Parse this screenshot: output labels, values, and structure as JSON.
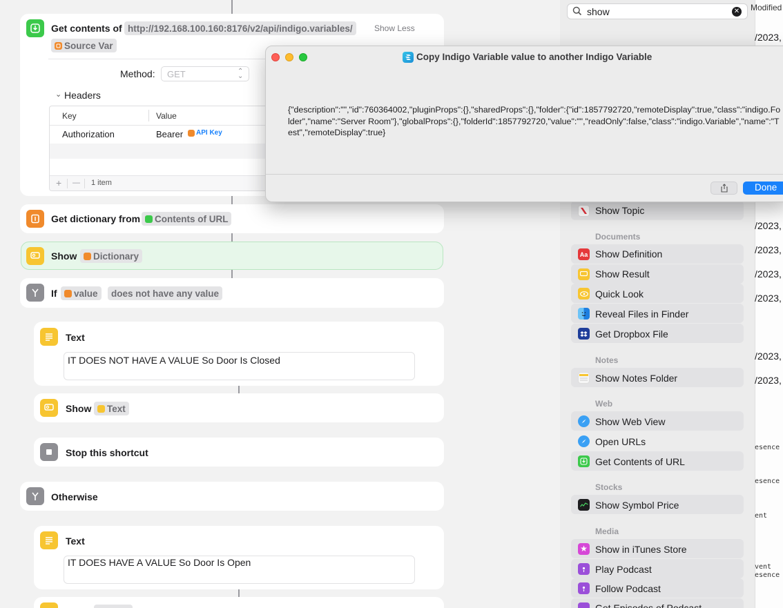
{
  "editor": {
    "get_contents": {
      "label": "Get contents of",
      "url": "http://192.168.100.160:8176/v2/api/indigo.variables/",
      "show_less": "Show Less",
      "source_var": "Source Var",
      "method_label": "Method:",
      "method_value": "GET",
      "headers_label": "Headers",
      "col_key": "Key",
      "col_value": "Value",
      "header_key": "Authorization",
      "header_value_prefix": "Bearer",
      "header_value_token": "API Key",
      "item_count": "1 item",
      "add_symbol": "+",
      "remove_symbol": "—"
    },
    "get_dictionary": {
      "label": "Get dictionary from",
      "token": "Contents of URL"
    },
    "show_dictionary": {
      "label": "Show",
      "token": "Dictionary"
    },
    "if_action": {
      "label": "If",
      "token": "value",
      "condition": "does not have any value"
    },
    "text1": {
      "label": "Text",
      "content": "IT DOES NOT HAVE A VALUE So Door Is Closed"
    },
    "show_text": {
      "label": "Show",
      "token": "Text"
    },
    "stop": {
      "label": "Stop this shortcut"
    },
    "otherwise": {
      "label": "Otherwise"
    },
    "text2": {
      "label": "Text",
      "content": "IT DOES HAVE A VALUE So Door Is Open"
    }
  },
  "sidebar": {
    "search_value": "show",
    "top_fragment": "Modified",
    "items": {
      "show_topic": "Show Topic",
      "show_definition": "Show Definition",
      "show_result": "Show Result",
      "quick_look": "Quick Look",
      "reveal_files": "Reveal Files in Finder",
      "get_dropbox": "Get Dropbox File",
      "show_notes_folder": "Show Notes Folder",
      "show_web_view": "Show Web View",
      "open_urls": "Open URLs",
      "get_contents_url": "Get Contents of URL",
      "show_symbol_price": "Show Symbol Price",
      "show_itunes": "Show in iTunes Store",
      "play_podcast": "Play Podcast",
      "follow_podcast": "Follow Podcast",
      "get_episodes": "Get Episodes of Podcast"
    },
    "headers": {
      "documents": "Documents",
      "notes": "Notes",
      "web": "Web",
      "stocks": "Stocks",
      "media": "Media"
    }
  },
  "background_fragments": {
    "date": "/2023,",
    "presence": "esence",
    "ent": "ent",
    "vent": "vent"
  },
  "dialog": {
    "title": "Copy Indigo Variable value to another Indigo Variable",
    "body": "{\"description\":\"\",\"id\":760364002,\"pluginProps\":{},\"sharedProps\":{},\"folder\":{\"id\":1857792720,\"remoteDisplay\":true,\"class\":\"indigo.Folder\",\"name\":\"Server Room\"},\"globalProps\":{},\"folderId\":1857792720,\"value\":\"\",\"readOnly\":false,\"class\":\"indigo.Variable\",\"name\":\"Test\",\"remoteDisplay\":true}",
    "done_label": "Done"
  },
  "colors": {
    "green": "#3cc94b",
    "orange": "#f08a2c",
    "yellow": "#f7c531",
    "gray": "#8e8e93",
    "blue": "#1a82fb",
    "show_highlight": "#e7f7ea"
  }
}
